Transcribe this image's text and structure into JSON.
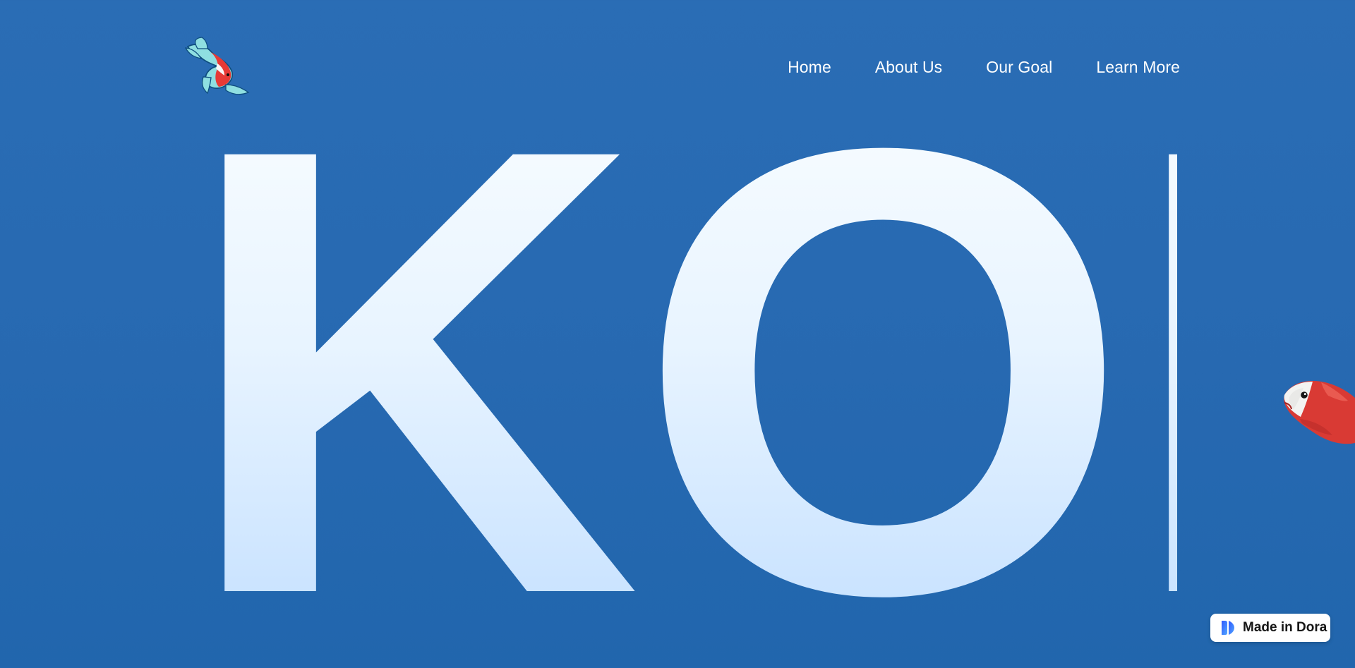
{
  "nav": {
    "logo_alt": "koi fish logo",
    "links": [
      {
        "label": "Home"
      },
      {
        "label": "About Us"
      },
      {
        "label": "Our Goal"
      },
      {
        "label": "Learn More"
      }
    ]
  },
  "hero": {
    "title": "KOI"
  },
  "badge": {
    "label": "Made in Dora",
    "icon": "dora-logo-icon"
  },
  "colors": {
    "background": "#2a6db5",
    "hero_text_top": "#f7fcff",
    "hero_text_bottom": "#c6e1ff",
    "nav_text": "#ffffff",
    "badge_bg": "#ffffff",
    "badge_text": "#161616",
    "koi_red": "#e73a36",
    "koi_body": "#8fdfe1"
  }
}
